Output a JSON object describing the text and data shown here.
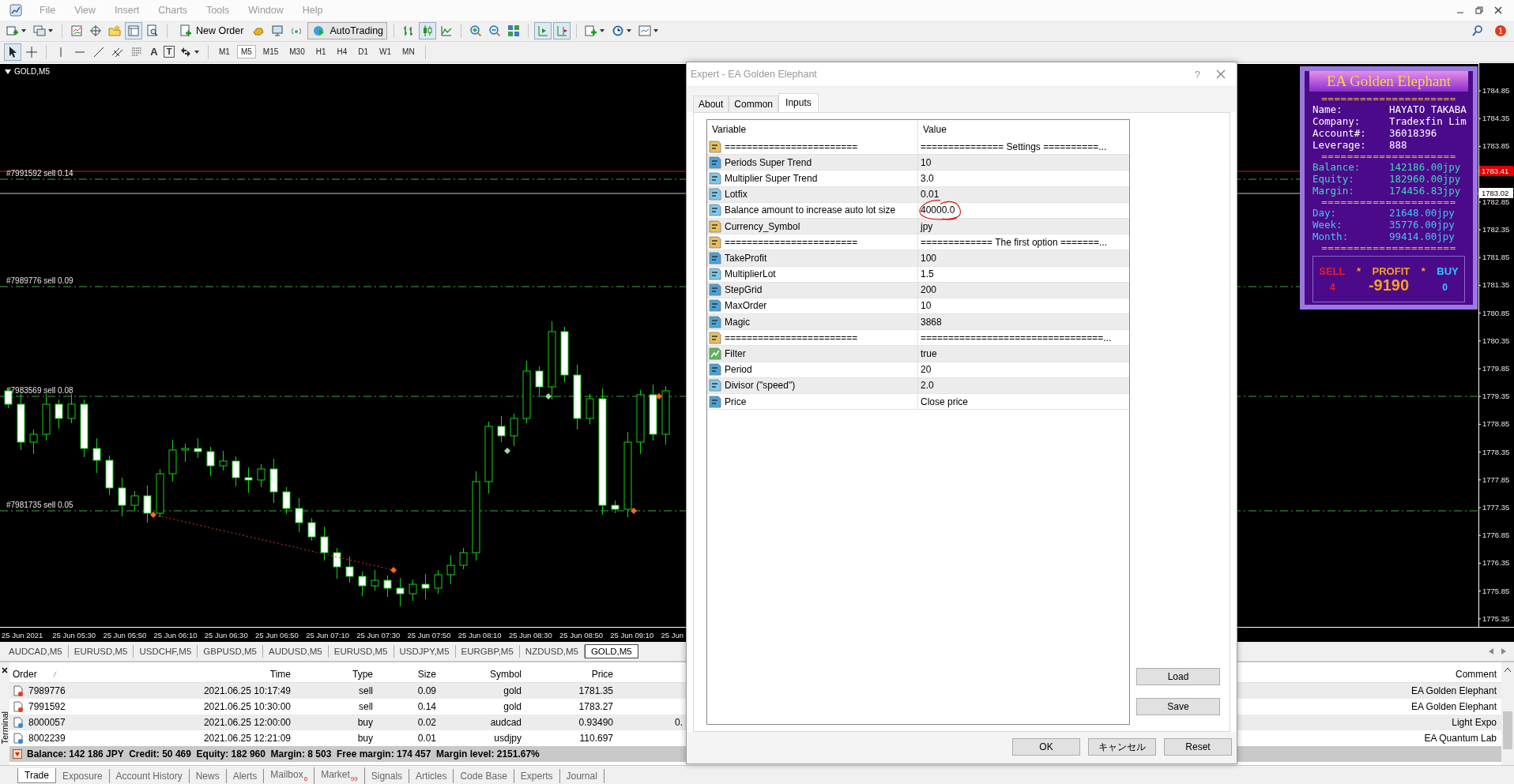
{
  "menu_bar": {
    "items": [
      {
        "label": "File",
        "disabled": true
      },
      {
        "label": "View",
        "disabled": true
      },
      {
        "label": "Insert",
        "disabled": true
      },
      {
        "label": "Charts",
        "disabled": true
      },
      {
        "label": "Tools",
        "disabled": true
      },
      {
        "label": "Window",
        "disabled": true
      },
      {
        "label": "Help",
        "disabled": true
      }
    ]
  },
  "toolbar": {
    "new_order": "New Order",
    "autotrading": {
      "label": "AutoTrading",
      "on": true
    },
    "notifications": "1"
  },
  "drawing_tools": {
    "text_tool": "A",
    "label_tool": "T"
  },
  "periods": [
    {
      "label": "M1",
      "selected": false
    },
    {
      "label": "M5",
      "selected": true
    },
    {
      "label": "M15",
      "selected": false
    },
    {
      "label": "M30",
      "selected": false
    },
    {
      "label": "H1",
      "selected": false
    },
    {
      "label": "H4",
      "selected": false
    },
    {
      "label": "D1",
      "selected": false
    },
    {
      "label": "W1",
      "selected": false
    },
    {
      "label": "MN",
      "selected": false
    }
  ],
  "chart": {
    "title": "GOLD,M5",
    "order_lines": [
      {
        "label": "#7991592 sell 0.14"
      },
      {
        "label": "#7989776 sell 0.09"
      },
      {
        "label": "#7983569 sell 0.08"
      },
      {
        "label": "#7981735 sell 0.05"
      }
    ],
    "price_labels": [
      "1784.85",
      "1784.35",
      "1783.85",
      "1782.85",
      "1782.35",
      "1781.85",
      "1781.35",
      "1780.85",
      "1780.35",
      "1779.85",
      "1779.35",
      "1778.85",
      "1778.35",
      "1777.85",
      "1777.35",
      "1776.85",
      "1776.35",
      "1775.85",
      "1775.35"
    ],
    "price_tags": [
      {
        "text": "1783.41",
        "kind": "bid"
      },
      {
        "text": "1783.02",
        "kind": "ask"
      }
    ],
    "time_labels": [
      "25 Jun 2021",
      "25 Jun 05:30",
      "25 Jun 05:50",
      "25 Jun 06:10",
      "25 Jun 06:30",
      "25 Jun 06:50",
      "25 Jun 07:10",
      "25 Jun 07:30",
      "25 Jun 07:50",
      "25 Jun 08:10",
      "25 Jun 08:30",
      "25 Jun 08:50",
      "25 Jun 09:10",
      "25 Jun"
    ]
  },
  "ea_panel": {
    "title": "EA Golden Elephant",
    "separator": "=====================",
    "account": [
      {
        "label": "Name:",
        "value": "HAYATO TAKABA"
      },
      {
        "label": "Company:",
        "value": "Tradexfin Lim"
      },
      {
        "label": "Account#:",
        "value": "36018396"
      },
      {
        "label": "Leverage:",
        "value": "888"
      }
    ],
    "funds": [
      {
        "label": "Balance:",
        "value": "142186.00jpy"
      },
      {
        "label": "Equity:",
        "value": "182960.00jpy"
      },
      {
        "label": "Margin:",
        "value": "174456.83jpy"
      }
    ],
    "profits": [
      {
        "label": "Day:",
        "value": "21648.00jpy"
      },
      {
        "label": "Week:",
        "value": "35776.00jpy"
      },
      {
        "label": "Month:",
        "value": "99414.00jpy"
      }
    ],
    "summary": {
      "sell_label": "SELL",
      "star": "*",
      "profit_label": "PROFIT",
      "buy_label": "BUY",
      "sell_count": "4",
      "profit": "-9190",
      "buy_count": "0"
    }
  },
  "dialog": {
    "title": "Expert - EA Golden Elephant",
    "help": "?",
    "tabs": [
      {
        "label": "About",
        "selected": false
      },
      {
        "label": "Common",
        "selected": false
      },
      {
        "label": "Inputs",
        "selected": true
      }
    ],
    "columns": [
      "Variable",
      "Value"
    ],
    "parameters": [
      {
        "kind": "string",
        "variable": "========================",
        "value": "=============== Settings ==========...",
        "circled": false
      },
      {
        "kind": "int",
        "variable": "Periods Super Trend",
        "value": "10",
        "circled": false
      },
      {
        "kind": "double",
        "variable": "Multiplier Super Trend",
        "value": "3.0",
        "circled": false
      },
      {
        "kind": "double",
        "variable": "Lotfix",
        "value": "0.01",
        "circled": false
      },
      {
        "kind": "double",
        "variable": "Balance amount to increase auto lot size",
        "value": "40000.0",
        "circled": true
      },
      {
        "kind": "string",
        "variable": "Currency_Symbol",
        "value": "jpy",
        "circled": false
      },
      {
        "kind": "string",
        "variable": "========================",
        "value": "============= The first option =======...",
        "circled": false
      },
      {
        "kind": "int",
        "variable": "TakeProfit",
        "value": "100",
        "circled": false
      },
      {
        "kind": "double",
        "variable": "MultiplierLot",
        "value": "1.5",
        "circled": false
      },
      {
        "kind": "int",
        "variable": "StepGrid",
        "value": "200",
        "circled": false
      },
      {
        "kind": "int",
        "variable": "MaxOrder",
        "value": "10",
        "circled": false
      },
      {
        "kind": "int",
        "variable": "Magic",
        "value": "3868",
        "circled": false
      },
      {
        "kind": "string",
        "variable": "========================",
        "value": "=================================...",
        "circled": false
      },
      {
        "kind": "bool",
        "variable": "Filter",
        "value": "true",
        "circled": false
      },
      {
        "kind": "int",
        "variable": "Period",
        "value": "20",
        "circled": false
      },
      {
        "kind": "double",
        "variable": "Divisor (\"speed\")",
        "value": "2.0",
        "circled": false
      },
      {
        "kind": "int",
        "variable": "Price",
        "value": "Close price",
        "circled": false
      }
    ],
    "side_buttons": [
      "Load",
      "Save"
    ],
    "footer_buttons": [
      "OK",
      "キャンセル",
      "Reset"
    ]
  },
  "symbol_tabs": [
    {
      "label": "AUDCAD,M5",
      "selected": false
    },
    {
      "label": "EURUSD,M5",
      "selected": false
    },
    {
      "label": "USDCHF,M5",
      "selected": false
    },
    {
      "label": "GBPUSD,M5",
      "selected": false
    },
    {
      "label": "AUDUSD,M5",
      "selected": false
    },
    {
      "label": "EURUSD,M5",
      "selected": false
    },
    {
      "label": "USDJPY,M5",
      "selected": false
    },
    {
      "label": "EURGBP,M5",
      "selected": false
    },
    {
      "label": "NZDUSD,M5",
      "selected": false
    },
    {
      "label": "GOLD,M5",
      "selected": true
    }
  ],
  "terminal": {
    "title": "Terminal",
    "columns": [
      "Order",
      "Time",
      "Type",
      "Size",
      "Symbol",
      "Price",
      "Comment"
    ],
    "rows": [
      {
        "kind": "sell",
        "order": "7989776",
        "time": "2021.06.25 10:17:49",
        "type": "sell",
        "size": "0.09",
        "symbol": "gold",
        "price": "1781.35",
        "comment": "EA Golden Elephant"
      },
      {
        "kind": "sell",
        "order": "7991592",
        "time": "2021.06.25 10:30:00",
        "type": "sell",
        "size": "0.14",
        "symbol": "gold",
        "price": "1783.27",
        "comment": "EA Golden Elephant"
      },
      {
        "kind": "buy",
        "order": "8000057",
        "time": "2021.06.25 12:00:00",
        "type": "buy",
        "size": "0.02",
        "symbol": "audcad",
        "price": "0.93490",
        "column_7": "0.",
        "comment": "Light Expo"
      },
      {
        "kind": "buy",
        "order": "8002239",
        "time": "2021.06.25 12:21:09",
        "type": "buy",
        "size": "0.01",
        "symbol": "usdjpy",
        "price": "110.697",
        "comment": "EA Quantum Lab"
      }
    ],
    "summary": "Balance: 142 186 JPY  Credit: 50 469  Equity: 182 960  Margin: 8 503  Free margin: 174 457  Margin level: 2151.67%",
    "tabs": [
      {
        "label": "Trade",
        "selected": true
      },
      {
        "label": "Exposure",
        "selected": false
      },
      {
        "label": "Account History",
        "selected": false
      },
      {
        "label": "News",
        "selected": false
      },
      {
        "label": "Alerts",
        "selected": false
      },
      {
        "label": "Mailbox",
        "badge": "6",
        "selected": false
      },
      {
        "label": "Market",
        "badge": "99",
        "selected": false
      },
      {
        "label": "Signals",
        "selected": false
      },
      {
        "label": "Articles",
        "selected": false
      },
      {
        "label": "Code Base",
        "selected": false
      },
      {
        "label": "Experts",
        "selected": false
      },
      {
        "label": "Journal",
        "selected": false
      }
    ]
  }
}
